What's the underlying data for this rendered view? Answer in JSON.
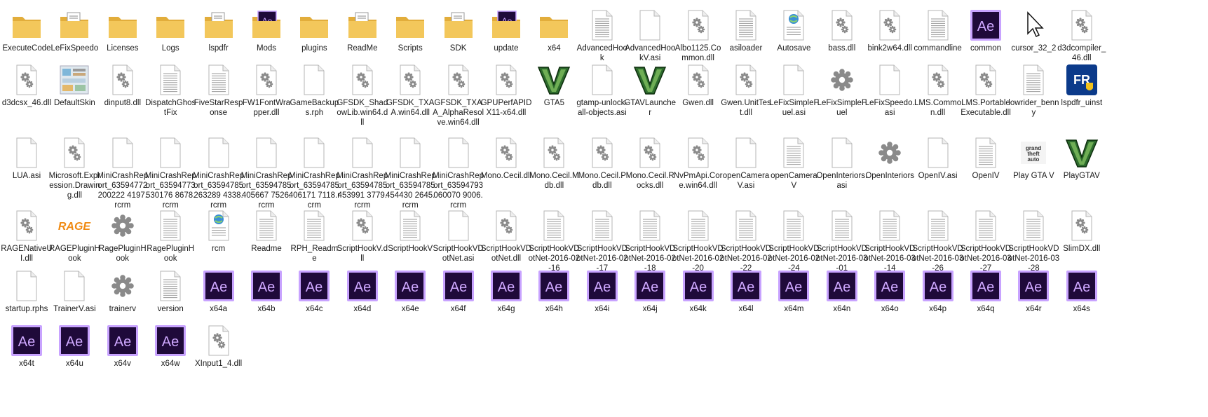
{
  "window": {
    "title": ""
  },
  "colors": {
    "folder": "#f3c75b",
    "folder_dark": "#e2ad3b",
    "ae_bg": "#1f0a3a",
    "ae_border": "#c8a3ff",
    "ae_text": "#cfa8ff",
    "paper": "#ffffff",
    "paper_line": "#9a9a9a",
    "gear": "#8a8a8a",
    "gta_green": "#2d6b2d",
    "rage": "#f08a12",
    "lspd_blue": "#0b3a8a"
  },
  "files": [
    {
      "name": "ExecuteCode",
      "type": "folder"
    },
    {
      "name": "LeFixSpeedo",
      "type": "folder-doc"
    },
    {
      "name": "Licenses",
      "type": "folder"
    },
    {
      "name": "Logs",
      "type": "folder"
    },
    {
      "name": "lspdfr",
      "type": "folder-doc"
    },
    {
      "name": "Mods",
      "type": "folder-ae"
    },
    {
      "name": "plugins",
      "type": "folder"
    },
    {
      "name": "ReadMe",
      "type": "folder-doc"
    },
    {
      "name": "Scripts",
      "type": "folder"
    },
    {
      "name": "SDK",
      "type": "folder-doc"
    },
    {
      "name": "update",
      "type": "folder-ae"
    },
    {
      "name": "x64",
      "type": "folder"
    },
    {
      "name": "AdvancedHook",
      "type": "text"
    },
    {
      "name": "AdvancedHookV.asi",
      "type": "blank"
    },
    {
      "name": "Albo1125.Common.dll",
      "type": "dll"
    },
    {
      "name": "asiloader",
      "type": "text"
    },
    {
      "name": "Autosave",
      "type": "web"
    },
    {
      "name": "bass.dll",
      "type": "dll"
    },
    {
      "name": "bink2w64.dll",
      "type": "dll"
    },
    {
      "name": "commandline",
      "type": "text"
    },
    {
      "name": "common",
      "type": "ae"
    },
    {
      "name": "cursor_32_2",
      "type": "cursor"
    },
    {
      "name": "d3dcompiler_46.dll",
      "type": "dll"
    },
    {
      "name": "d3dcsx_46.dll",
      "type": "dll"
    },
    {
      "name": "DefaultSkin",
      "type": "skin"
    },
    {
      "name": "dinput8.dll",
      "type": "dll"
    },
    {
      "name": "DispatchGhostFix",
      "type": "text"
    },
    {
      "name": "FiveStarResponse",
      "type": "text"
    },
    {
      "name": "FW1FontWrapper.dll",
      "type": "dll"
    },
    {
      "name": "GameBackups.rph",
      "type": "blank"
    },
    {
      "name": "GFSDK_ShadowLib.win64.dll",
      "type": "dll"
    },
    {
      "name": "GFSDK_TXAA.win64.dll",
      "type": "dll"
    },
    {
      "name": "GFSDK_TXAA_AlphaResolve.win64.dll",
      "type": "dll"
    },
    {
      "name": "GPUPerfAPIDX11-x64.dll",
      "type": "dll"
    },
    {
      "name": "GTA5",
      "type": "gtav"
    },
    {
      "name": "gtamp-unlock-all-objects.asi",
      "type": "blank"
    },
    {
      "name": "GTAVLauncher",
      "type": "gtav"
    },
    {
      "name": "Gwen.dll",
      "type": "dll"
    },
    {
      "name": "Gwen.UnitTest.dll",
      "type": "dll"
    },
    {
      "name": "LeFixSimpleFuel.asi",
      "type": "blank"
    },
    {
      "name": "LeFixSimpleFuel",
      "type": "gear"
    },
    {
      "name": "LeFixSpeedo.asi",
      "type": "blank"
    },
    {
      "name": "LMS.Common.dll",
      "type": "dll"
    },
    {
      "name": "LMS.PortableExecutable.dll",
      "type": "dll"
    },
    {
      "name": "lowrider_benny",
      "type": "text"
    },
    {
      "name": "lspdfr_uinst",
      "type": "lspdfr"
    },
    {
      "name": "LUA.asi",
      "type": "blank"
    },
    {
      "name": "Microsoft.Expression.Drawing.dll",
      "type": "dll"
    },
    {
      "name": "MiniCrashReport_63594772200222 4197.rcrm",
      "type": "blank"
    },
    {
      "name": "MiniCrashReport_63594773530176 8678.rcrm",
      "type": "blank"
    },
    {
      "name": "MiniCrashReport_63594785263289 4338.rcrm",
      "type": "blank"
    },
    {
      "name": "MiniCrashReport_63594785405667 7526.rcrm",
      "type": "blank"
    },
    {
      "name": "MiniCrashReport_63594785406171 7118.rcrm",
      "type": "blank"
    },
    {
      "name": "MiniCrashReport_63594785453991 3779.rcrm",
      "type": "blank"
    },
    {
      "name": "MiniCrashReport_63594785454430 2645.rcrm",
      "type": "blank"
    },
    {
      "name": "MiniCrashReport_63594793060070 9006.rcrm",
      "type": "blank"
    },
    {
      "name": "Mono.Cecil.dll",
      "type": "dll"
    },
    {
      "name": "Mono.Cecil.Mdb.dll",
      "type": "dll"
    },
    {
      "name": "Mono.Cecil.Pdb.dll",
      "type": "dll"
    },
    {
      "name": "Mono.Cecil.Rocks.dll",
      "type": "dll"
    },
    {
      "name": "NvPmApi.Core.win64.dll",
      "type": "dll"
    },
    {
      "name": "openCameraV.asi",
      "type": "blank"
    },
    {
      "name": "openCameraV",
      "type": "text"
    },
    {
      "name": "OpenInteriors.asi",
      "type": "blank"
    },
    {
      "name": "OpenInteriors",
      "type": "gear"
    },
    {
      "name": "OpenIV.asi",
      "type": "blank"
    },
    {
      "name": "OpenIV",
      "type": "text"
    },
    {
      "name": "Play GTA V",
      "type": "gtalogo"
    },
    {
      "name": "PlayGTAV",
      "type": "gtav"
    },
    {
      "name": "RAGENativeUI.dll",
      "type": "dll"
    },
    {
      "name": "RAGEPluginHook",
      "type": "rage"
    },
    {
      "name": "RagePluginHook",
      "type": "gear"
    },
    {
      "name": "RagePluginHook",
      "type": "text"
    },
    {
      "name": "rcm",
      "type": "web"
    },
    {
      "name": "Readme",
      "type": "text"
    },
    {
      "name": "RPH_Readme",
      "type": "text"
    },
    {
      "name": "ScriptHookV.dll",
      "type": "dll"
    },
    {
      "name": "ScriptHookV",
      "type": "text"
    },
    {
      "name": "ScriptHookVDotNet.asi",
      "type": "blank"
    },
    {
      "name": "ScriptHookVDotNet.dll",
      "type": "dll"
    },
    {
      "name": "ScriptHookVDotNet-2016-02-16",
      "type": "text"
    },
    {
      "name": "ScriptHookVDotNet-2016-02-17",
      "type": "text"
    },
    {
      "name": "ScriptHookVDotNet-2016-02-18",
      "type": "text"
    },
    {
      "name": "ScriptHookVDotNet-2016-02-20",
      "type": "text"
    },
    {
      "name": "ScriptHookVDotNet-2016-02-22",
      "type": "text"
    },
    {
      "name": "ScriptHookVDotNet-2016-02-24",
      "type": "text"
    },
    {
      "name": "ScriptHookVDotNet-2016-03-01",
      "type": "text"
    },
    {
      "name": "ScriptHookVDotNet-2016-03-14",
      "type": "text"
    },
    {
      "name": "ScriptHookVDotNet-2016-03-26",
      "type": "text"
    },
    {
      "name": "ScriptHookVDotNet-2016-03-27",
      "type": "text"
    },
    {
      "name": "ScriptHookVDotNet-2016-03-28",
      "type": "text"
    },
    {
      "name": "SlimDX.dll",
      "type": "dll"
    },
    {
      "name": "startup.rphs",
      "type": "blank"
    },
    {
      "name": "TrainerV.asi",
      "type": "blank"
    },
    {
      "name": "trainerv",
      "type": "gear"
    },
    {
      "name": "version",
      "type": "text"
    },
    {
      "name": "x64a",
      "type": "ae"
    },
    {
      "name": "x64b",
      "type": "ae"
    },
    {
      "name": "x64c",
      "type": "ae"
    },
    {
      "name": "x64d",
      "type": "ae"
    },
    {
      "name": "x64e",
      "type": "ae"
    },
    {
      "name": "x64f",
      "type": "ae"
    },
    {
      "name": "x64g",
      "type": "ae"
    },
    {
      "name": "x64h",
      "type": "ae"
    },
    {
      "name": "x64i",
      "type": "ae"
    },
    {
      "name": "x64j",
      "type": "ae"
    },
    {
      "name": "x64k",
      "type": "ae"
    },
    {
      "name": "x64l",
      "type": "ae"
    },
    {
      "name": "x64m",
      "type": "ae"
    },
    {
      "name": "x64n",
      "type": "ae"
    },
    {
      "name": "x64o",
      "type": "ae"
    },
    {
      "name": "x64p",
      "type": "ae"
    },
    {
      "name": "x64q",
      "type": "ae"
    },
    {
      "name": "x64r",
      "type": "ae"
    },
    {
      "name": "x64s",
      "type": "ae"
    },
    {
      "name": "x64t",
      "type": "ae"
    },
    {
      "name": "x64u",
      "type": "ae"
    },
    {
      "name": "x64v",
      "type": "ae"
    },
    {
      "name": "x64w",
      "type": "ae"
    },
    {
      "name": "XInput1_4.dll",
      "type": "dll"
    }
  ],
  "icon_names": {
    "folder": "folder-icon",
    "folder-doc": "folder-with-document-icon",
    "folder-ae": "folder-with-ae-icon",
    "text": "text-document-icon",
    "blank": "blank-file-icon",
    "dll": "dll-gear-file-icon",
    "ae": "adobe-after-effects-icon",
    "web": "web-document-icon",
    "cursor": "cursor-icon",
    "skin": "skin-image-icon",
    "gtav": "gta-v-logo-icon",
    "gear": "gear-settings-icon",
    "lspdfr": "lspdfr-shield-icon",
    "gtalogo": "grand-theft-auto-logo-icon",
    "rage": "rage-logo-icon"
  },
  "ae_text": "Ae",
  "rage_text": "RAGE",
  "gtalogo_text": "grand theft auto"
}
